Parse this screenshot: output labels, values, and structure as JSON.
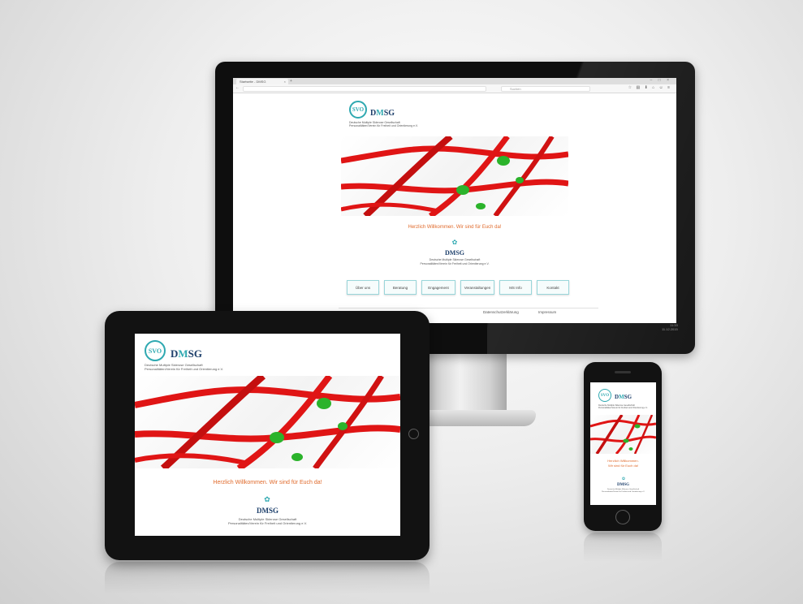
{
  "site": {
    "logo_mark": "SVO",
    "brand_prefix": "D",
    "brand_accent": "M",
    "brand_suffix": "SG",
    "logo_line1": "Deutsche Multiple Sklerose Gesellschaft",
    "logo_line2": "Personalitäten/Verein für Freiheit und Orientierung e.V.",
    "tagline_desktop": "Herzlich Willkommen. Wir sind für Euch da!",
    "tagline_tablet": "Herzlich Willkommen. Wir sind für Euch da!",
    "tagline_phone_1": "Herzlich Willkommen.",
    "tagline_phone_2": "Wir sind für Euch da!",
    "mini_brand": "DMSG",
    "mini_line1": "Deutsche Multiple Sklerose Gesellschaft",
    "mini_line2": "Personalitäten/Verein für Freiheit und Orientierung e.V."
  },
  "browser": {
    "tab_title": "Startseite - DMSG",
    "search_placeholder": "Suchen"
  },
  "nav": {
    "items": [
      "Über uns",
      "Beratung",
      "Engagement",
      "Veranstaltungen",
      "MS Info",
      "Kontakt"
    ]
  },
  "footer": {
    "privacy": "Datenschutzerklärung",
    "imprint": "Impressum"
  },
  "os": {
    "time": "11:33",
    "date": "11.12.2015"
  },
  "colors": {
    "accent": "#2fa9b1",
    "tagline": "#e06a2b",
    "rope": "#e01515",
    "knot": "#2bb32b"
  }
}
